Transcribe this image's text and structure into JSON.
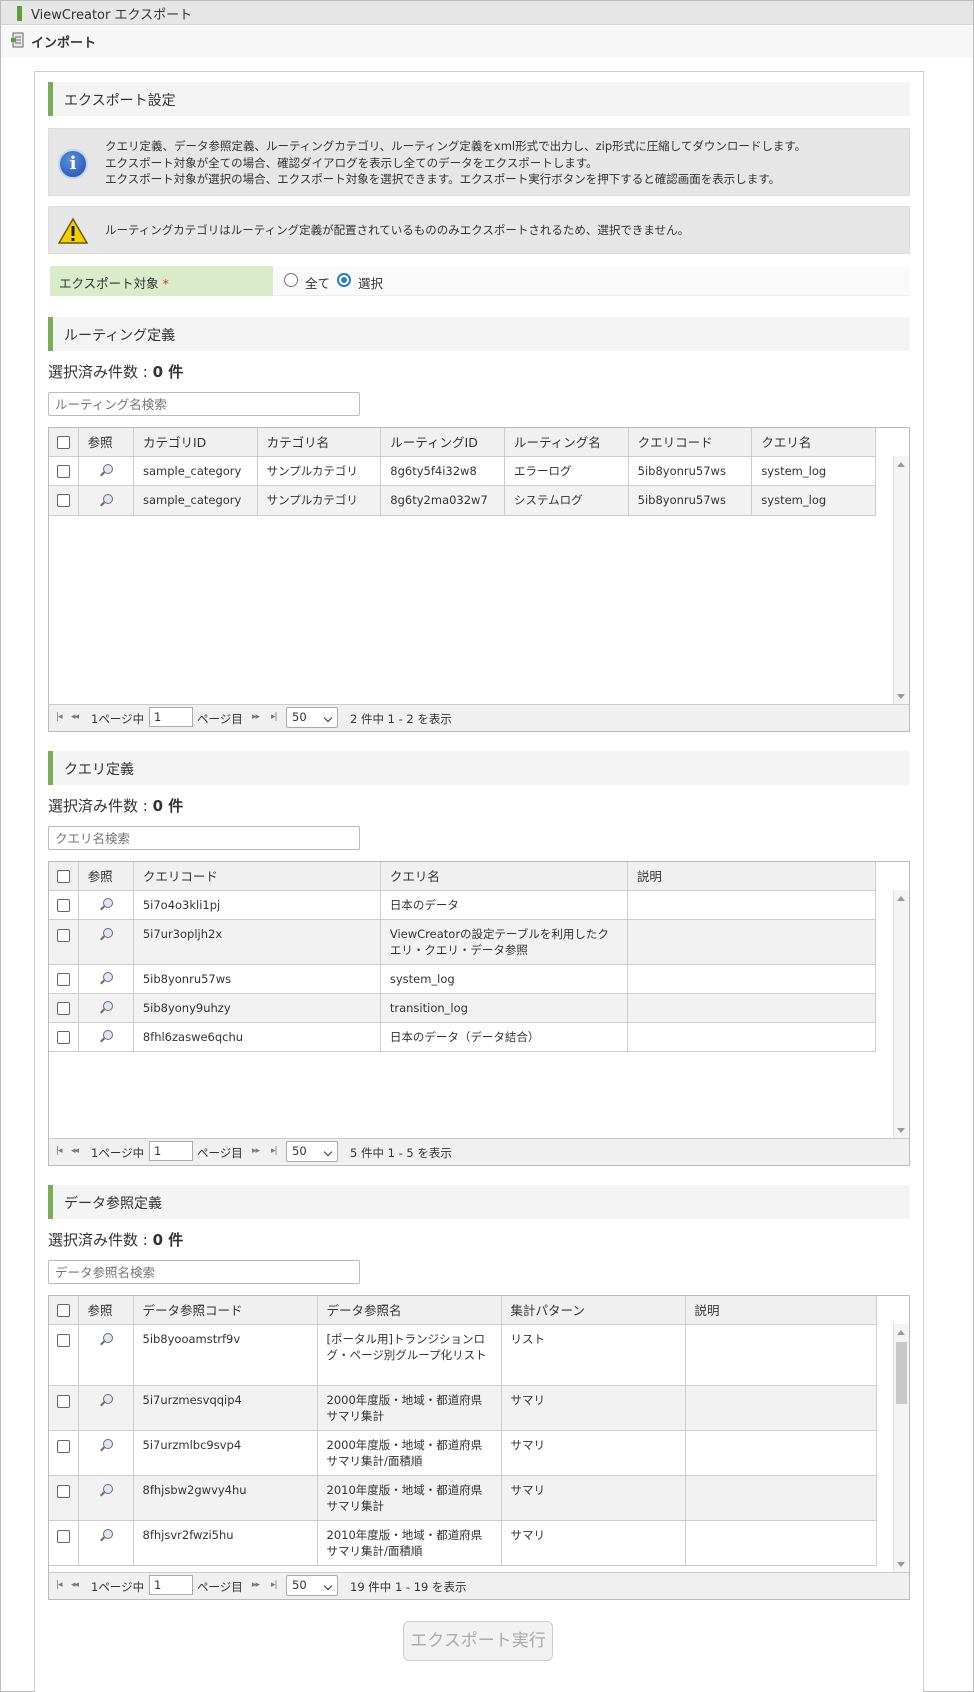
{
  "app": {
    "title": "ViewCreator エクスポート"
  },
  "toolbar": {
    "import_label": "インポート"
  },
  "section_main": {
    "title": "エクスポート設定"
  },
  "info": {
    "lines": [
      "クエリ定義、データ参照定義、ルーティングカテゴリ、ルーティング定義をxml形式で出力し、zip形式に圧縮してダウンロードします。",
      "エクスポート対象が全ての場合、確認ダイアログを表示し全てのデータをエクスポートします。",
      "エクスポート対象が選択の場合、エクスポート対象を選択できます。エクスポート実行ボタンを押下すると確認画面を表示します。"
    ]
  },
  "warning": {
    "text": "ルーティングカテゴリはルーティング定義が配置されているもののみエクスポートされるため、選択できません。"
  },
  "export_target": {
    "label": "エクスポート対象",
    "required_mark": "*",
    "options": [
      {
        "label": "全て",
        "checked": false
      },
      {
        "label": "選択",
        "checked": true
      }
    ]
  },
  "routing": {
    "title": "ルーティング定義",
    "count_label": "選択済み件数 : ",
    "count_value": "0 件",
    "search_placeholder": "ルーティング名検索",
    "headers": [
      "参照",
      "カテゴリID",
      "カテゴリ名",
      "ルーティングID",
      "ルーティング名",
      "クエリコード",
      "クエリ名"
    ],
    "rows": [
      [
        "sample_category",
        "サンプルカテゴリ",
        "8g6ty5f4i32w8",
        "エラーログ",
        "5ib8yonru57ws",
        "system_log"
      ],
      [
        "sample_category",
        "サンプルカテゴリ",
        "8g6ty2ma032w7",
        "システムログ",
        "5ib8yonru57ws",
        "system_log"
      ]
    ],
    "pager": {
      "page_prefix": "1ページ中",
      "page_value": "1",
      "page_suffix": "ページ目",
      "per_page": "50",
      "summary": "2 件中 1 - 2 を表示"
    }
  },
  "query": {
    "title": "クエリ定義",
    "count_label": "選択済み件数 : ",
    "count_value": "0 件",
    "search_placeholder": "クエリ名検索",
    "headers": [
      "参照",
      "クエリコード",
      "クエリ名",
      "説明"
    ],
    "rows": [
      [
        "5i7o4o3kli1pj",
        "日本のデータ",
        ""
      ],
      [
        "5i7ur3opljh2x",
        "ViewCreatorの設定テーブルを利用したクエリ・クエリ・データ参照",
        ""
      ],
      [
        "5ib8yonru57ws",
        "system_log",
        ""
      ],
      [
        "5ib8yony9uhzy",
        "transition_log",
        ""
      ],
      [
        "8fhl6zaswe6qchu",
        "日本のデータ（データ結合）",
        ""
      ]
    ],
    "pager": {
      "page_prefix": "1ページ中",
      "page_value": "1",
      "page_suffix": "ページ目",
      "per_page": "50",
      "summary": "5 件中 1 - 5 を表示"
    }
  },
  "dataref": {
    "title": "データ参照定義",
    "count_label": "選択済み件数 : ",
    "count_value": "0 件",
    "search_placeholder": "データ参照名検索",
    "headers": [
      "参照",
      "データ参照コード",
      "データ参照名",
      "集計パターン",
      "説明"
    ],
    "rows": [
      [
        "5ib8yooamstrf9v",
        "[ポータル用]トランジションログ・ページ別グループ化リスト",
        "リスト",
        ""
      ],
      [
        "5i7urzmesvqqip4",
        "2000年度版・地域・都道府県サマリ集計",
        "サマリ",
        ""
      ],
      [
        "5i7urzmlbc9svp4",
        "2000年度版・地域・都道府県サマリ集計/面積順",
        "サマリ",
        ""
      ],
      [
        "8fhjsbw2gwvy4hu",
        "2010年度版・地域・都道府県サマリ集計",
        "サマリ",
        ""
      ],
      [
        "8fhjsvr2fwzi5hu",
        "2010年度版・地域・都道府県サマリ集計/面積順",
        "サマリ",
        ""
      ]
    ],
    "pager": {
      "page_prefix": "1ページ中",
      "page_value": "1",
      "page_suffix": "ページ目",
      "per_page": "50",
      "summary": "19 件中 1 - 19 を表示"
    }
  },
  "export_button": {
    "label": "エクスポート実行"
  }
}
